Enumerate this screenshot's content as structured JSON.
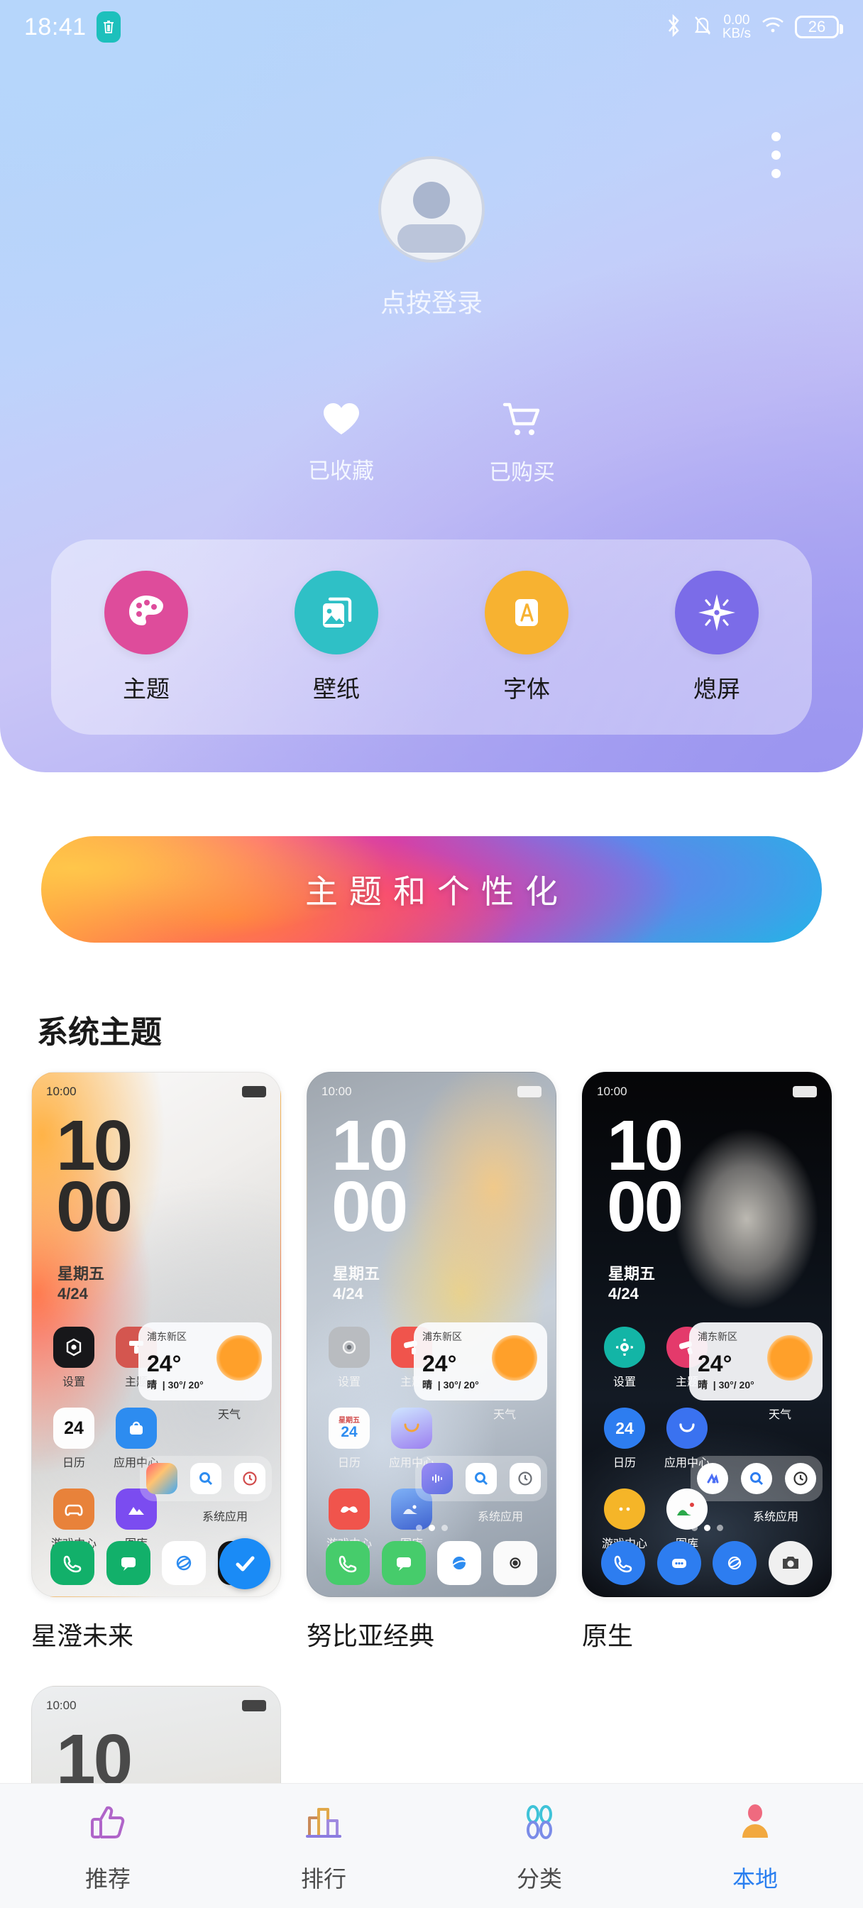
{
  "status_bar": {
    "time": "18:41",
    "trash_icon": "trash-icon",
    "bluetooth_icon": "bluetooth-icon",
    "mute_icon": "bell-muted-icon",
    "network_speed_value": "0.00",
    "network_speed_unit": "KB/s",
    "wifi_icon": "wifi-icon",
    "battery_level": "26"
  },
  "header": {
    "more_menu_icon": "more-vertical-icon",
    "avatar_icon": "avatar-placeholder-icon",
    "login_label": "点按登录",
    "quick_links": [
      {
        "icon": "heart-icon",
        "label": "已收藏"
      },
      {
        "icon": "cart-icon",
        "label": "已购买"
      }
    ],
    "categories": [
      {
        "label": "主题",
        "icon": "palette-icon",
        "color": "#de4c9b"
      },
      {
        "label": "壁纸",
        "icon": "image-icon",
        "color": "#2fc0c6"
      },
      {
        "label": "字体",
        "icon": "font-a-icon",
        "color": "#f7b231"
      },
      {
        "label": "熄屏",
        "icon": "sparkle-icon",
        "color": "#7b6ce8"
      }
    ]
  },
  "banner": {
    "title": "主题和个性化"
  },
  "section": {
    "title": "系统主题"
  },
  "themes": [
    {
      "name": "星澄未来",
      "applied": true,
      "applied_badge_icon": "check-icon",
      "preview": {
        "status_time": "10:00",
        "clock_hour": "10",
        "clock_minute": "00",
        "weekday": "星期五",
        "date": "4/24",
        "apps": [
          "设置",
          "主题",
          "日历",
          "应用中心",
          "游戏中心",
          "图库"
        ],
        "calendar_day": "24",
        "folder_label": "系统应用",
        "weather": {
          "location": "浦东新区",
          "temp": "24°",
          "desc": "晴",
          "range": "30°/ 20°",
          "label": "天气"
        }
      }
    },
    {
      "name": "努比亚经典",
      "applied": false,
      "preview": {
        "status_time": "10:00",
        "clock_hour": "10",
        "clock_minute": "00",
        "weekday": "星期五",
        "date": "4/24",
        "apps": [
          "设置",
          "主题",
          "日历",
          "应用中心",
          "游戏中心",
          "图库"
        ],
        "calendar_day": "24",
        "calendar_weekday": "星期五",
        "folder_label": "系统应用",
        "weather": {
          "location": "浦东新区",
          "temp": "24°",
          "desc": "晴",
          "range": "30°/ 20°",
          "label": "天气"
        }
      }
    },
    {
      "name": "原生",
      "applied": false,
      "preview": {
        "status_time": "10:00",
        "clock_hour": "10",
        "clock_minute": "00",
        "weekday": "星期五",
        "date": "4/24",
        "apps": [
          "设置",
          "主题",
          "日历",
          "应用中心",
          "游戏中心",
          "图库"
        ],
        "calendar_day": "24",
        "folder_label": "系统应用",
        "weather": {
          "location": "浦东新区",
          "temp": "24°",
          "desc": "晴",
          "range": "30°/ 20°",
          "label": "天气"
        }
      }
    }
  ],
  "theme_partial": {
    "status_time": "10:00",
    "clock_hour": "10"
  },
  "bottom_nav": [
    {
      "label": "推荐",
      "icon": "thumbs-up-icon",
      "active": false
    },
    {
      "label": "排行",
      "icon": "bar-chart-icon",
      "active": false
    },
    {
      "label": "分类",
      "icon": "grid-petals-icon",
      "active": false
    },
    {
      "label": "本地",
      "icon": "person-icon",
      "active": true
    }
  ],
  "colors": {
    "accent": "#2a7ff0",
    "applied_badge": "#1a8bf6",
    "trash_chip": "#1dc0bc"
  }
}
